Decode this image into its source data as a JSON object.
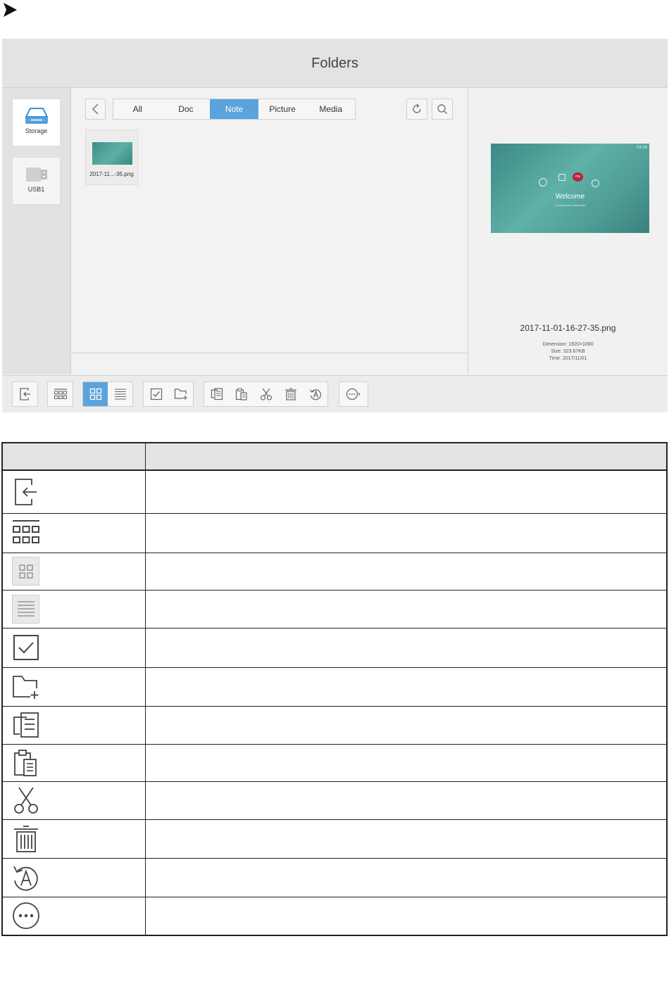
{
  "page": {
    "marker_icon": "chevron-right-icon"
  },
  "app": {
    "title": "Folders"
  },
  "sidebar": {
    "items": [
      {
        "label": "Storage",
        "icon": "storage-drive-icon"
      },
      {
        "label": "USB1",
        "icon": "usb-drive-icon"
      }
    ]
  },
  "filter_tabs": [
    {
      "label": "All",
      "active": false
    },
    {
      "label": "Doc",
      "active": false
    },
    {
      "label": "Note",
      "active": true
    },
    {
      "label": "Picture",
      "active": false
    },
    {
      "label": "Media",
      "active": false
    }
  ],
  "header_icons": [
    "back-icon",
    "refresh-icon",
    "search-icon"
  ],
  "files": [
    {
      "name": "2017-11...-35.png"
    }
  ],
  "preview": {
    "clock": "03:26",
    "welcome": "Welcome",
    "tagline": "Connect and Collaborate",
    "badge": "my",
    "filename": "2017-11-01-16-27-35.png",
    "dimension": "Dimension: 1920×1080",
    "size": "Size: 323.67KB",
    "time": "Time: 2017/11/01"
  },
  "toolbar": {
    "groups": [
      [
        "exit-icon"
      ],
      [
        "thumbnail-view-icon"
      ],
      [
        "grid-view-icon",
        "list-view-icon"
      ],
      [
        "multi-select-icon",
        "new-folder-icon"
      ],
      [
        "copy-icon",
        "paste-icon",
        "cut-icon",
        "delete-icon",
        "rename-icon"
      ],
      [
        "more-icon"
      ]
    ],
    "selected": "grid-view-icon"
  },
  "legend_table": {
    "headers": [
      "",
      ""
    ],
    "rows": [
      {
        "icon": "exit-icon",
        "description": ""
      },
      {
        "icon": "thumbnail-view-icon",
        "description": ""
      },
      {
        "icon": "grid-view-icon",
        "description": ""
      },
      {
        "icon": "list-view-icon",
        "description": ""
      },
      {
        "icon": "multi-select-icon",
        "description": ""
      },
      {
        "icon": "new-folder-icon",
        "description": ""
      },
      {
        "icon": "copy-icon",
        "description": ""
      },
      {
        "icon": "paste-icon",
        "description": ""
      },
      {
        "icon": "cut-icon",
        "description": ""
      },
      {
        "icon": "delete-icon",
        "description": ""
      },
      {
        "icon": "rename-icon",
        "description": ""
      },
      {
        "icon": "more-icon",
        "description": ""
      }
    ]
  }
}
